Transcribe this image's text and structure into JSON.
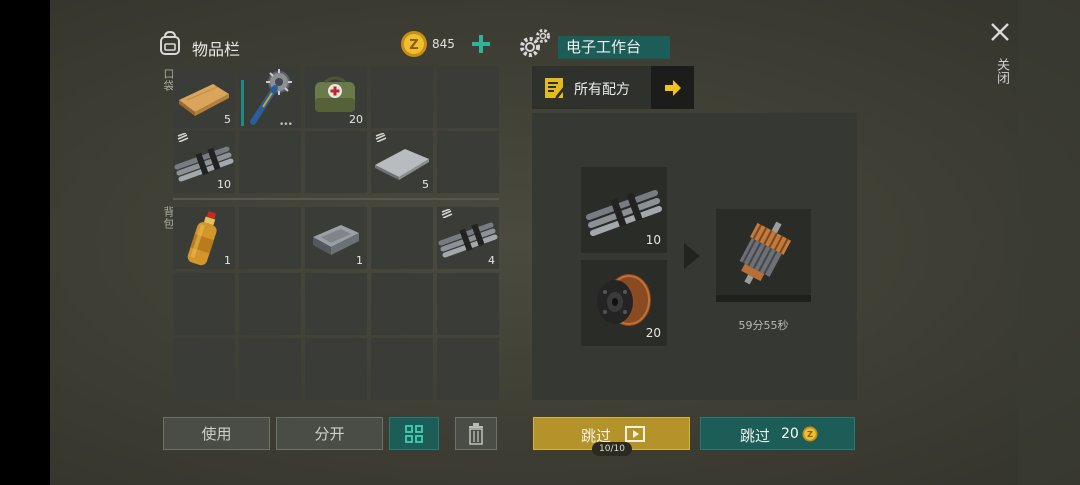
{
  "inventory": {
    "title": "物品栏",
    "coins": "845",
    "pocket_label": "口袋",
    "backpack_label": "背包",
    "pocket_slots": [
      {
        "item": "wooden-plank",
        "count": "5"
      },
      {
        "item": "spiked-club",
        "count": ""
      },
      {
        "item": "medical-bag",
        "count": "20"
      },
      {
        "item": "",
        "count": ""
      },
      {
        "item": "",
        "count": ""
      },
      {
        "item": "rebar",
        "count": "10"
      },
      {
        "item": "",
        "count": ""
      },
      {
        "item": "",
        "count": ""
      },
      {
        "item": "metal-plate",
        "count": "5"
      },
      {
        "item": "",
        "count": ""
      }
    ],
    "backpack_slots": [
      {
        "item": "juice-bottle",
        "count": "1"
      },
      {
        "item": "",
        "count": ""
      },
      {
        "item": "iron-ingot",
        "count": "1"
      },
      {
        "item": "",
        "count": ""
      },
      {
        "item": "rebar",
        "count": "4"
      },
      {
        "item": "",
        "count": ""
      },
      {
        "item": "",
        "count": ""
      },
      {
        "item": "",
        "count": ""
      },
      {
        "item": "",
        "count": ""
      },
      {
        "item": "",
        "count": ""
      },
      {
        "item": "",
        "count": ""
      },
      {
        "item": "",
        "count": ""
      },
      {
        "item": "",
        "count": ""
      },
      {
        "item": "",
        "count": ""
      },
      {
        "item": "",
        "count": ""
      }
    ],
    "buttons": {
      "use": "使用",
      "split": "分开"
    }
  },
  "workbench": {
    "title": "电子工作台",
    "recipes_label": "所有配方",
    "ingredients": [
      {
        "item": "rebar",
        "count": "10"
      },
      {
        "item": "copper-wire-spool",
        "count": "20"
      }
    ],
    "output": {
      "item": "electric-motor-rotor",
      "timer": "59分55秒",
      "progress": 0
    },
    "skip_ad_label": "跳过",
    "skip_ad_uses": "10/10",
    "skip_coin_label": "跳过",
    "skip_coin_cost": "20"
  },
  "close_label": "关闭",
  "colors": {
    "teal": "#1d5d58",
    "gold": "#b3932a",
    "accent_green": "#2fb39a",
    "coin": "#d9a520"
  }
}
